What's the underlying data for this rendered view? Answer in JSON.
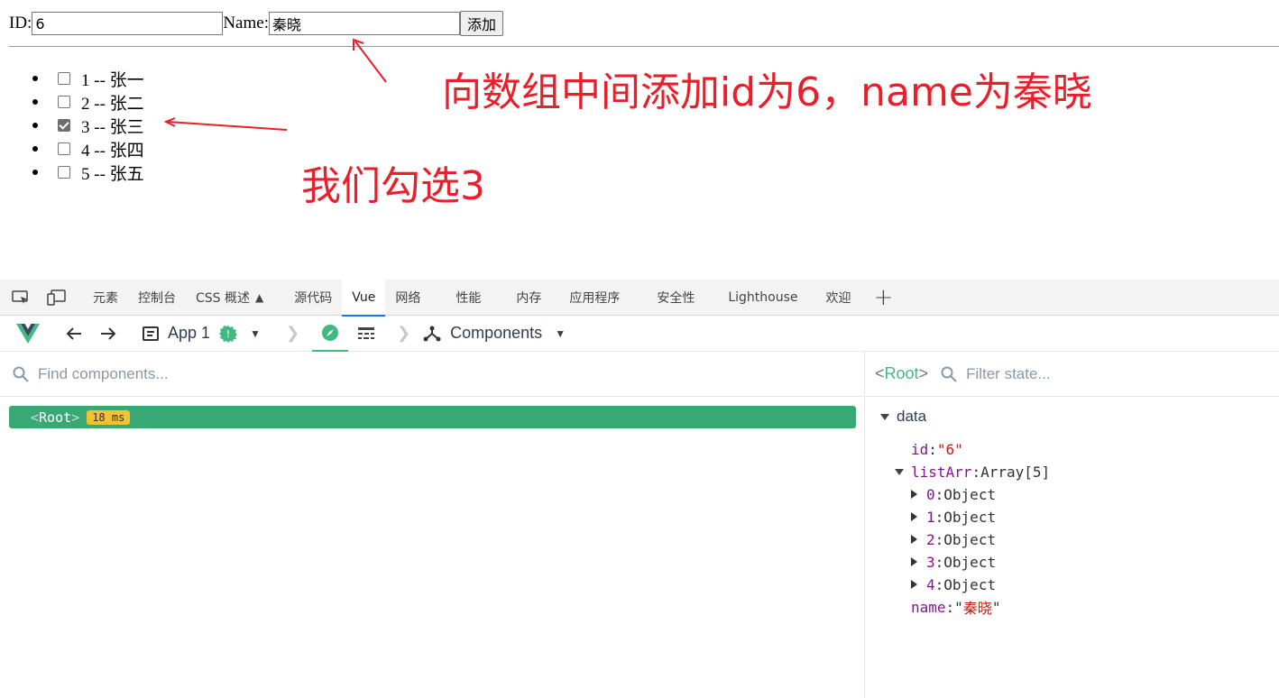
{
  "form": {
    "id_label": "ID:",
    "id_value": "6",
    "name_label": "Name:",
    "name_value": "秦晓",
    "add_button": "添加"
  },
  "list": [
    {
      "text": "1 -- 张一",
      "checked": false
    },
    {
      "text": "2 -- 张二",
      "checked": false
    },
    {
      "text": "3 -- 张三",
      "checked": true
    },
    {
      "text": "4 -- 张四",
      "checked": false
    },
    {
      "text": "5 -- 张五",
      "checked": false
    }
  ],
  "annotations": {
    "note1": "向数组中间添加id为6，name为秦晓",
    "note2": "我们勾选3",
    "color": "#e8202b"
  },
  "devtools": {
    "tabs": [
      "元素",
      "控制台",
      "CSS 概述",
      "源代码",
      "Vue",
      "网络",
      "性能",
      "内存",
      "应用程序",
      "安全性",
      "Lighthouse",
      "欢迎"
    ],
    "active_tab": "Vue",
    "plus": "+"
  },
  "vue": {
    "app_label": "App 1",
    "components_label": "Components",
    "find_placeholder": "Find components...",
    "root_open": "<",
    "root_name": "Root",
    "root_close": ">",
    "root_time": "18 ms",
    "right_root_open": "<",
    "right_root_name": "Root",
    "right_root_close": ">",
    "filter_placeholder": "Filter state...",
    "section": "data",
    "state": {
      "id_key": "id",
      "id_value": "\"6\"",
      "list_key": "listArr",
      "list_value": "Array[5]",
      "items": [
        {
          "index": "0",
          "value": "Object"
        },
        {
          "index": "1",
          "value": "Object"
        },
        {
          "index": "2",
          "value": "Object"
        },
        {
          "index": "3",
          "value": "Object"
        },
        {
          "index": "4",
          "value": "Object"
        }
      ],
      "name_key": "name",
      "name_q1": "\"",
      "name_value": "秦晓",
      "name_q2": "\""
    },
    "accent": "#42b883",
    "root_bg": "#3ba776",
    "badge_bg": "#f2c230"
  }
}
